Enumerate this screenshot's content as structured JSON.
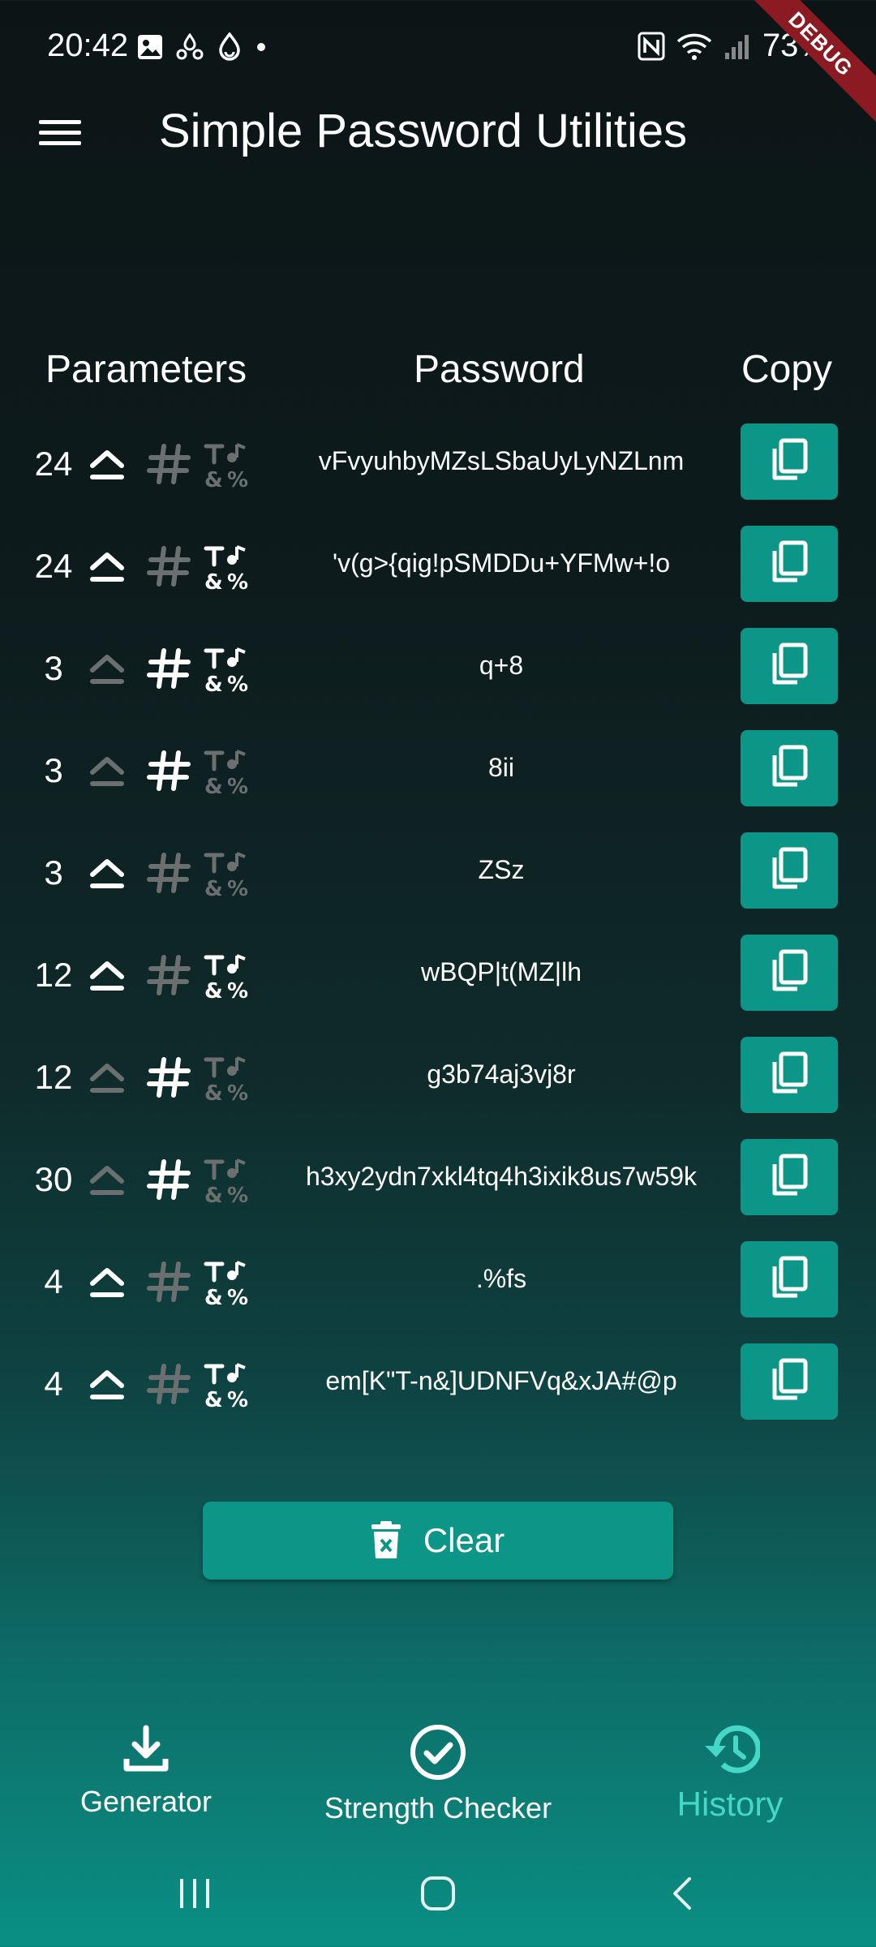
{
  "status_bar": {
    "time": "20:42",
    "battery": "73%",
    "debug_label": "DEBUG"
  },
  "app_bar": {
    "title": "Simple Password Utilities",
    "menu_icon": "hamburger-menu-icon"
  },
  "table": {
    "headers": {
      "parameters": "Parameters",
      "password": "Password",
      "copy": "Copy"
    },
    "rows": [
      {
        "length": "24",
        "uppercase": true,
        "numbers": false,
        "symbols": false,
        "password": "vFvyuhbyMZsLSbaUyLyNZLnm"
      },
      {
        "length": "24",
        "uppercase": true,
        "numbers": false,
        "symbols": true,
        "password": "'v(g>{qig!pSMDDu+YFMw+!o"
      },
      {
        "length": "3",
        "uppercase": false,
        "numbers": true,
        "symbols": true,
        "password": "q+8"
      },
      {
        "length": "3",
        "uppercase": false,
        "numbers": true,
        "symbols": false,
        "password": "8ii"
      },
      {
        "length": "3",
        "uppercase": true,
        "numbers": false,
        "symbols": false,
        "password": "ZSz"
      },
      {
        "length": "12",
        "uppercase": true,
        "numbers": false,
        "symbols": true,
        "password": "wBQP|t(MZ|lh"
      },
      {
        "length": "12",
        "uppercase": false,
        "numbers": true,
        "symbols": false,
        "password": "g3b74aj3vj8r"
      },
      {
        "length": "30",
        "uppercase": false,
        "numbers": true,
        "symbols": false,
        "password": "h3xy2ydn7xkl4tq4h3ixik8us7w59k"
      },
      {
        "length": "4",
        "uppercase": true,
        "numbers": false,
        "symbols": true,
        "password": ".%fs"
      },
      {
        "length": "4",
        "uppercase": true,
        "numbers": false,
        "symbols": true,
        "password": "em[K\"T-n&]UDNFVq&xJA#@p"
      }
    ]
  },
  "clear_button": {
    "label": "Clear"
  },
  "bottom_nav": {
    "items": [
      {
        "label": "Generator",
        "icon": "download-icon"
      },
      {
        "label": "Strength Checker",
        "icon": "check-circle-icon"
      },
      {
        "label": "History",
        "icon": "history-icon",
        "active": true
      }
    ]
  },
  "colors": {
    "accent": "#0b9688",
    "active_nav": "#46d8c7",
    "inactive_icon": "#6b6f70"
  }
}
